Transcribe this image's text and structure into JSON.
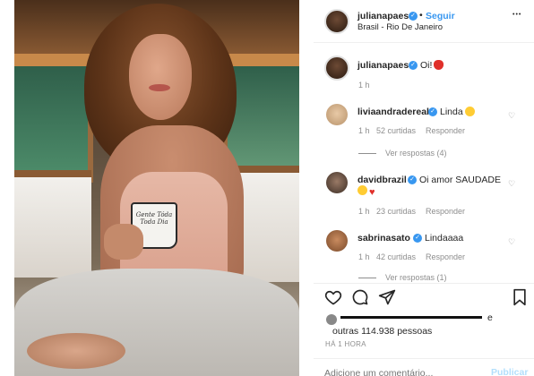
{
  "header": {
    "username": "julianapaes",
    "follow_label": "Seguir",
    "separator": "•",
    "location": "Brasil - Rio De Janeiro",
    "more_label": "•••"
  },
  "photo": {
    "mug_text": "Gente Tóda Toda Dia"
  },
  "caption": {
    "username": "julianapaes",
    "text": "Oi!",
    "time": "1 h"
  },
  "comments": [
    {
      "username": "liviaandradereal",
      "text": "Linda",
      "emoji": "heart-eyes",
      "time": "1 h",
      "likes": "52 curtidas",
      "reply_label": "Responder",
      "replies": "Ver respostas (4)"
    },
    {
      "username": "davidbrazil",
      "text": "Oi amor SAUDADE",
      "time": "1 h",
      "likes": "23 curtidas",
      "reply_label": "Responder"
    },
    {
      "username": "sabrinasato",
      "text": "Lindaaaa",
      "time": "1 h",
      "likes": "42 curtidas",
      "reply_label": "Responder",
      "replies": "Ver respostas (1)"
    }
  ],
  "actions": {
    "like_icon": "heart-outline-icon",
    "comment_icon": "comment-bubble-icon",
    "share_icon": "paper-plane-icon",
    "save_icon": "bookmark-icon"
  },
  "likes": {
    "text": "outras 114.938 pessoas",
    "prefix_char": "e"
  },
  "time_ago": "HÁ 1 HORA",
  "comment_box": {
    "placeholder": "Adicione um comentário...",
    "publish_label": "Publicar"
  },
  "colors": {
    "accent": "#3897f0",
    "muted": "#8e8e8e",
    "publish_disabled": "#b2dffc"
  }
}
